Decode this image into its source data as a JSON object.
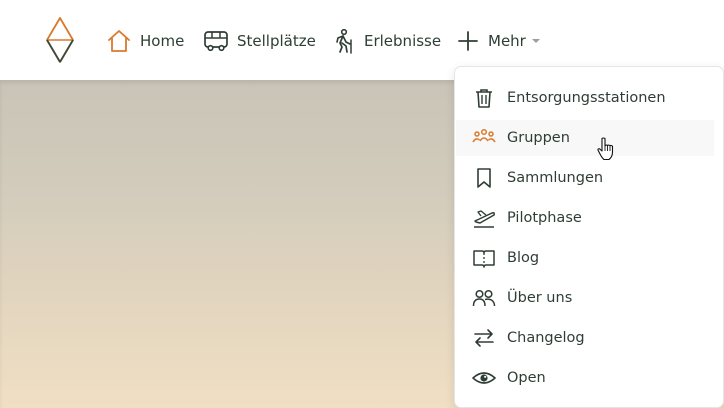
{
  "nav": {
    "home": "Home",
    "stellplaetze": "Stellplätze",
    "erlebnisse": "Erlebnisse",
    "mehr": "Mehr"
  },
  "icons": {
    "logo": "diamond-logo-icon",
    "home": "home-icon",
    "stellplaetze": "bus-icon",
    "erlebnisse": "hiker-icon",
    "mehr": "plus-icon"
  },
  "colors": {
    "brand_orange": "#d97a2b",
    "text_dark": "#2f3e34"
  },
  "dropdown": {
    "items": [
      {
        "label": "Entsorgungsstationen",
        "icon": "trash-icon"
      },
      {
        "label": "Gruppen",
        "icon": "group-icon"
      },
      {
        "label": "Sammlungen",
        "icon": "bookmark-icon"
      },
      {
        "label": "Pilotphase",
        "icon": "airplane-icon"
      },
      {
        "label": "Blog",
        "icon": "book-icon"
      },
      {
        "label": "Über uns",
        "icon": "users-icon"
      },
      {
        "label": "Changelog",
        "icon": "arrows-exchange-icon"
      },
      {
        "label": "Open",
        "icon": "eye-icon"
      }
    ]
  }
}
